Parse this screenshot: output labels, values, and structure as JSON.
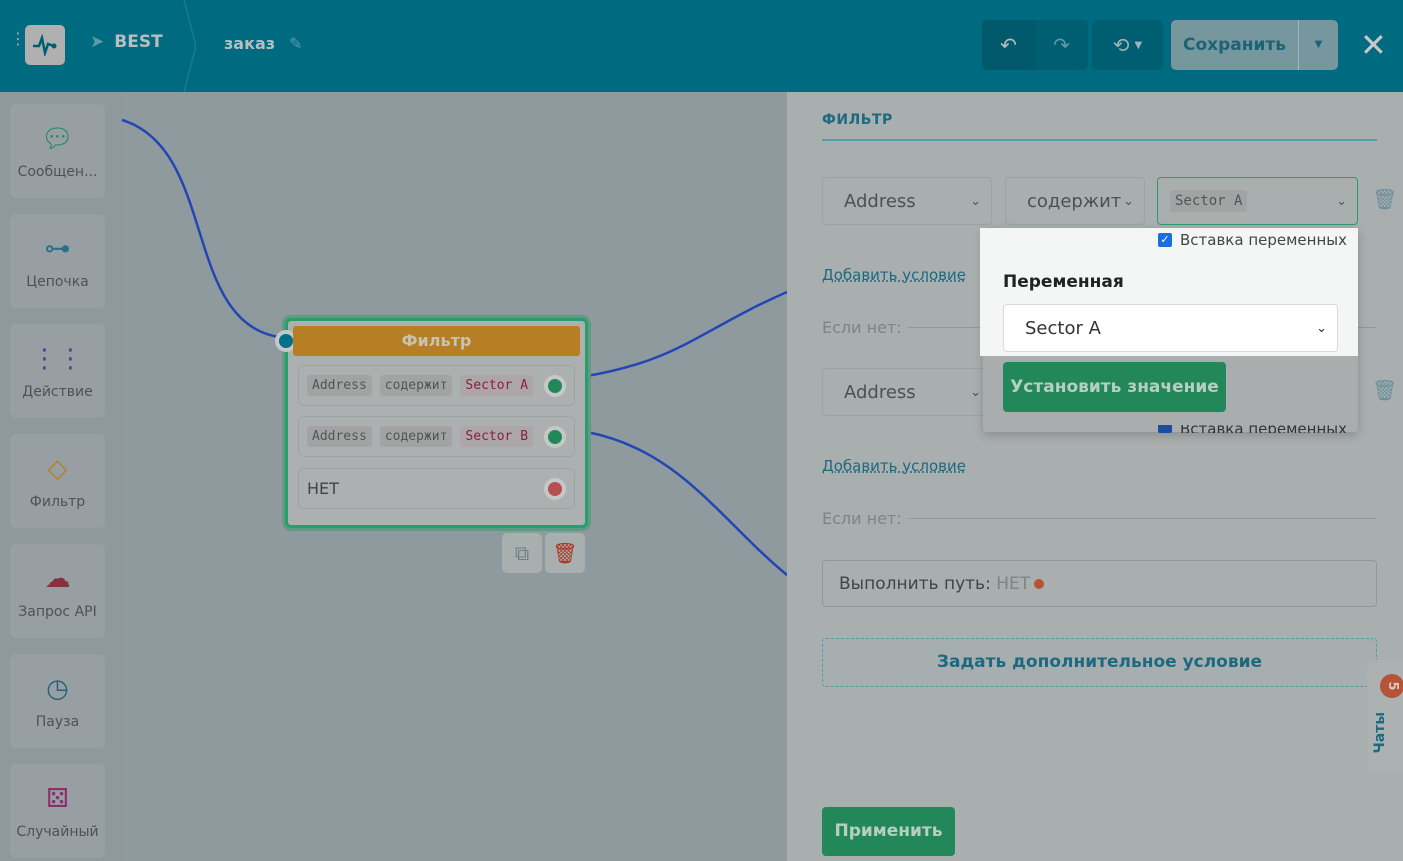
{
  "header": {
    "bot_name": "BEST",
    "project_name": "заказ",
    "save_label": "Сохранить",
    "icons": [
      "menu-dots-icon",
      "pulse-logo-icon",
      "telegram-icon",
      "pencil-icon",
      "undo-icon",
      "redo-icon",
      "history-icon",
      "caret-down-icon",
      "close-icon"
    ]
  },
  "sidebar": {
    "items": [
      {
        "label": "Сообщен...",
        "icon": "chat-icon"
      },
      {
        "label": "Цепочка",
        "icon": "chain-icon"
      },
      {
        "label": "Действие",
        "icon": "action-icon"
      },
      {
        "label": "Фильтр",
        "icon": "filter-icon"
      },
      {
        "label": "Запрос API",
        "icon": "cloud-icon"
      },
      {
        "label": "Пауза",
        "icon": "timer-icon"
      },
      {
        "label": "Случайный",
        "icon": "dice-icon"
      }
    ]
  },
  "node": {
    "title": "Фильтр",
    "rows": [
      {
        "field": "Address",
        "op": "содержит",
        "value": "Sector A",
        "port": "#22885a"
      },
      {
        "field": "Address",
        "op": "содержит",
        "value": "Sector B",
        "port": "#22885a"
      }
    ],
    "else_label": "НЕТ",
    "else_port": "#b55050"
  },
  "panel": {
    "title": "ФИЛЬТР",
    "conditions": [
      {
        "field": "Address",
        "op": "содержит",
        "value": "Sector A"
      },
      {
        "field": "Address"
      }
    ],
    "insert_vars_label": "Вставка переменных",
    "add_condition": "Добавить условие",
    "if_not": "Если нет:",
    "path_label": "Выполнить путь:",
    "path_value": "НЕТ",
    "add_extra": "Задать дополнительное условие",
    "apply": "Применить"
  },
  "popup": {
    "var_label": "Переменная",
    "var_value": "Sector A",
    "set_button": "Установить значение",
    "insert_vars_checked": true
  },
  "chats": {
    "label": "Чаты",
    "count": "5"
  }
}
